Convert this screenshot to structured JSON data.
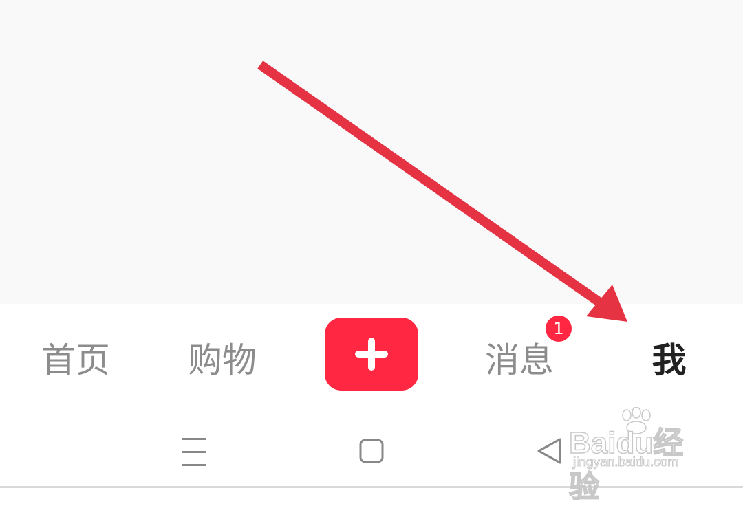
{
  "tab_bar": {
    "tabs": [
      {
        "label": "首页",
        "active": false
      },
      {
        "label": "购物",
        "active": false
      },
      {
        "label": "消息",
        "active": false,
        "badge": "1"
      },
      {
        "label": "我",
        "active": true
      }
    ],
    "publish_icon": "plus-icon"
  },
  "system_nav": {
    "icons": [
      "menu-icon",
      "home-square-icon",
      "back-triangle-icon"
    ]
  },
  "annotation": {
    "type": "arrow",
    "color": "#e53344"
  },
  "watermark": {
    "brand": "Baidu经验",
    "url": "jingyan.baidu.com"
  },
  "colors": {
    "accent": "#ff2741",
    "active_tab": "#222222",
    "inactive_tab": "#8c8c8c",
    "content_bg": "#f9f9fa"
  }
}
